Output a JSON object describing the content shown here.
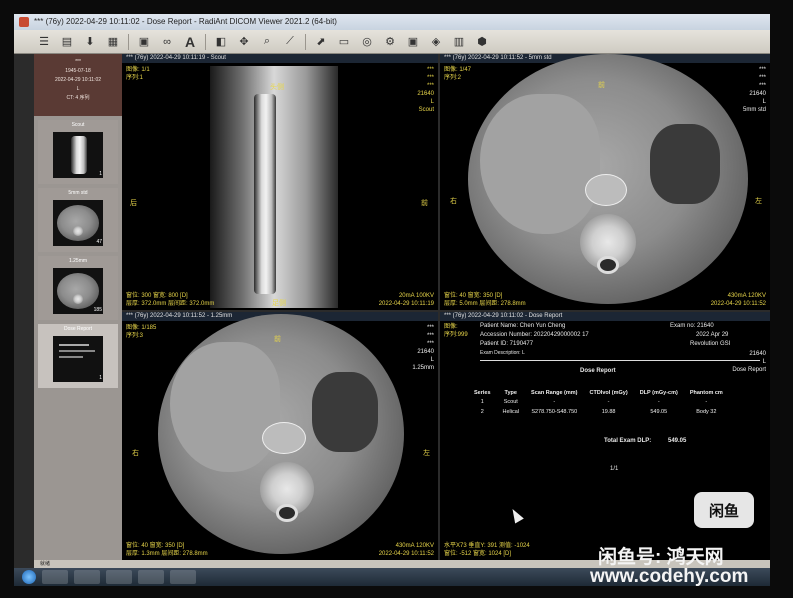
{
  "window": {
    "title": "*** (76y)   2022-04-29 10:11:02 - Dose Report - RadiAnt DICOM Viewer 2021.2 (64-bit)"
  },
  "toolbar": {
    "buttons": [
      "grid-layout-icon",
      "open-folder-icon",
      "save-icon",
      "print-icon",
      "layout-icon",
      "link-icon",
      "annotation-text-icon",
      "window-level-icon",
      "pan-icon",
      "zoom-icon",
      "measure-icon",
      "arrow-icon",
      "cine-icon",
      "export-icon",
      "settings-icon"
    ]
  },
  "sidebar": {
    "patient": {
      "name": "***",
      "birth": "1945-07-18",
      "study_date": "2022-04-29 10:11:02",
      "meta": "L",
      "modality": "CT: 4 序列"
    },
    "series": [
      {
        "label": "Scout",
        "count": "1"
      },
      {
        "label": "5mm std",
        "count": "47"
      },
      {
        "label": "1.25mm",
        "count": "185"
      },
      {
        "label": "Dose Report",
        "count": "1"
      }
    ]
  },
  "panes": {
    "scout": {
      "header": "*** (76y)  2022-04-29 10:11:19 - Scout",
      "tl": [
        "图像: 1/1",
        "序列:1"
      ],
      "tr": [
        "***",
        "***",
        "***",
        "21640",
        "L",
        "Scout"
      ],
      "top_label": "头侧",
      "left_label": "后",
      "right_label": "前",
      "bottom_label": "足侧",
      "bl": [
        "窗位: 300 窗宽: 800 [D]",
        "层厚: 372.0mm 层间距: 372.0mm"
      ],
      "br": [
        "20mA 100KV",
        "2022-04-29 10:11:19"
      ]
    },
    "std5": {
      "header": "*** (76y)  2022-04-29 10:11:52 - 5mm std",
      "tl": [
        "图像: 1/47",
        "序列:2"
      ],
      "tr": [
        "***",
        "***",
        "***",
        "21640",
        "L",
        "5mm std"
      ],
      "top_label": "前",
      "left_label": "右",
      "right_label": "左",
      "bl": [
        "窗位: 40 窗宽: 350 [D]",
        "层厚: 5.0mm 层间距: 278.8mm"
      ],
      "br": [
        "430mA 120KV",
        "2022-04-29 10:11:52"
      ]
    },
    "mm125": {
      "header": "*** (76y)  2022-04-29 10:11:52 - 1.25mm",
      "tl": [
        "图像: 1/185",
        "序列:3"
      ],
      "tr": [
        "***",
        "***",
        "***",
        "21640",
        "L",
        "1.25mm"
      ],
      "top_label": "前",
      "left_label": "右",
      "right_label": "左",
      "bl": [
        "窗位: 40 窗宽: 350 [D]",
        "层厚: 1.3mm 层间距: 278.8mm"
      ],
      "br": [
        "430mA 120KV",
        "2022-04-29 10:11:52"
      ]
    },
    "dose": {
      "header": "*** (76y)  2022-04-29 10:11:02 - Dose Report",
      "tl": [
        "图像:",
        "序列:999"
      ],
      "patient_name": "Patient Name: Chen Yun Cheng",
      "exam_no": "Exam no: 21640",
      "accession": "Accession Number: 20220429000002 17",
      "exam_date": "2022 Apr 29",
      "patient_id": "Patient ID: 7190477",
      "scanner": "Revolution GSI",
      "exam_desc": "Exam Description: L",
      "report_title": "Dose Report",
      "tr": [
        "21640",
        "L",
        "Dose Report"
      ],
      "columns": [
        "Series",
        "Type",
        "Scan Range (mm)",
        "CTDIvol (mGy)",
        "DLP (mGy-cm)",
        "Phantom cm"
      ],
      "rows": [
        [
          "1",
          "Scout",
          "-",
          "-",
          "-",
          "-"
        ],
        [
          "2",
          "Helical",
          "S278.750-S48.750",
          "19.88",
          "549.05",
          "Body 32"
        ]
      ],
      "total_label": "Total Exam DLP:",
      "total_value": "549.05",
      "page": "1/1",
      "bl": [
        "水平X73 垂直Y: 391 测值: -1024",
        "窗位: -512 窗宽: 1024 [D]"
      ]
    }
  },
  "statusbar": {
    "text": "就绪"
  },
  "watermark": {
    "logo": "闲鱼",
    "text1": "闲鱼号: 鸿天网",
    "text2": "www.codehy.com"
  }
}
